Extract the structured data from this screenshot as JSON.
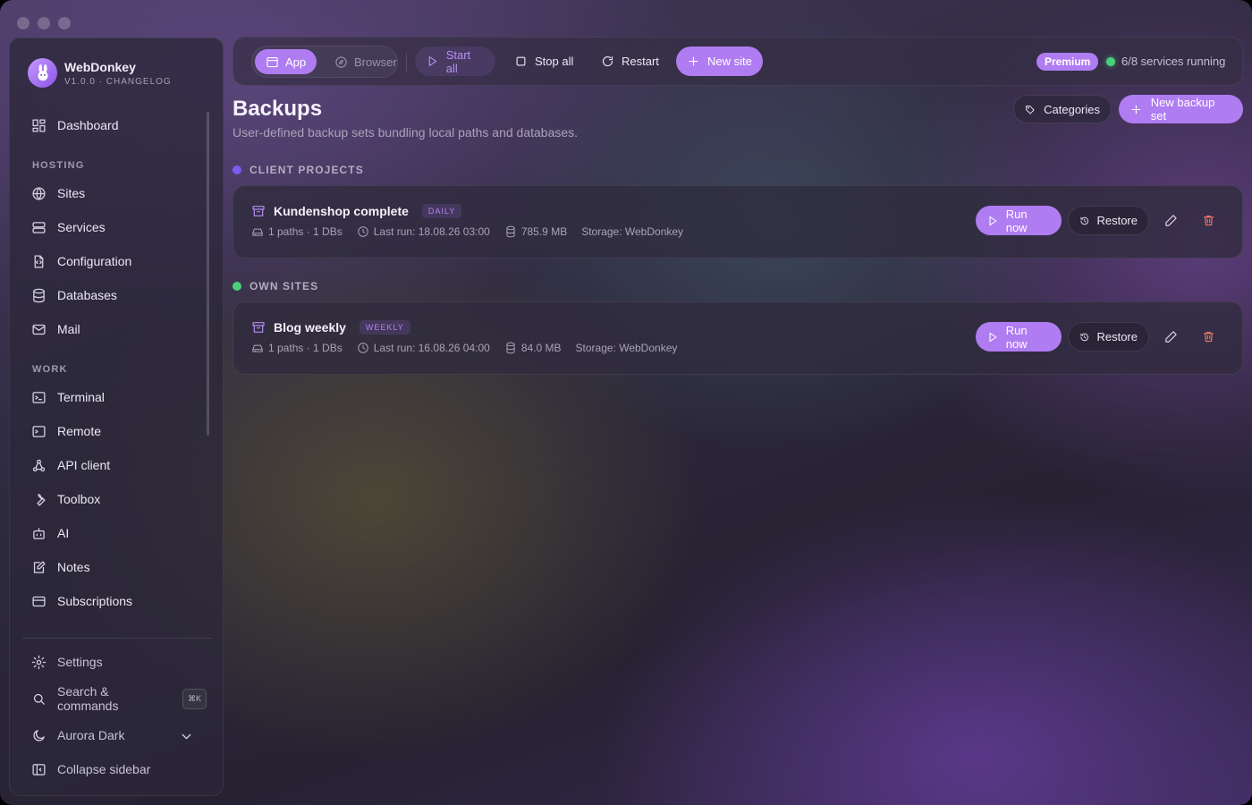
{
  "brand": {
    "name": "WebDonkey",
    "version": "V1.0.0 · CHANGELOG"
  },
  "sidebar": {
    "top": [
      {
        "label": "Dashboard",
        "icon": "dashboard-icon"
      }
    ],
    "sections": [
      {
        "title": "HOSTING",
        "items": [
          {
            "label": "Sites",
            "icon": "globe-icon"
          },
          {
            "label": "Services",
            "icon": "server-icon"
          },
          {
            "label": "Configuration",
            "icon": "config-file-icon"
          },
          {
            "label": "Databases",
            "icon": "database-icon"
          },
          {
            "label": "Mail",
            "icon": "mail-icon"
          }
        ]
      },
      {
        "title": "WORK",
        "items": [
          {
            "label": "Terminal",
            "icon": "terminal-icon"
          },
          {
            "label": "Remote",
            "icon": "remote-icon"
          },
          {
            "label": "API client",
            "icon": "api-icon"
          },
          {
            "label": "Toolbox",
            "icon": "wrench-icon"
          },
          {
            "label": "AI",
            "icon": "bot-icon"
          },
          {
            "label": "Notes",
            "icon": "notes-icon"
          },
          {
            "label": "Subscriptions",
            "icon": "card-icon"
          }
        ]
      }
    ],
    "footer": {
      "settings": "Settings",
      "search": "Search & commands",
      "search_shortcut": "⌘K",
      "theme": "Aurora Dark",
      "collapse": "Collapse sidebar"
    }
  },
  "toolbar": {
    "mode_app": "App",
    "mode_browser": "Browser",
    "start_all": "Start all",
    "stop_all": "Stop all",
    "restart": "Restart",
    "new_site": "New site",
    "plan_badge": "Premium",
    "status": "6/8 services running"
  },
  "page": {
    "title": "Backups",
    "subtitle": "User-defined backup sets bundling local paths and databases.",
    "categories_button": "Categories",
    "new_backup_button": "New backup set"
  },
  "groups": [
    {
      "label": "CLIENT PROJECTS",
      "color": "#7b5cf0",
      "sets": [
        {
          "name": "Kundenshop complete",
          "frequency": "DAILY",
          "paths": "1 paths · 1 DBs",
          "last_run": "Last run: 18.08.26 03:00",
          "size": "785.9 MB",
          "storage": "Storage: WebDonkey"
        }
      ]
    },
    {
      "label": "OWN SITES",
      "color": "#4bd07a",
      "sets": [
        {
          "name": "Blog weekly",
          "frequency": "WEEKLY",
          "paths": "1 paths · 1 DBs",
          "last_run": "Last run: 16.08.26 04:00",
          "size": "84.0 MB",
          "storage": "Storage: WebDonkey"
        }
      ]
    }
  ],
  "card_actions": {
    "run": "Run now",
    "restore": "Restore"
  },
  "colors": {
    "accent": "#b07cf2",
    "status_ok": "#4bd07a",
    "danger": "#f07a64"
  }
}
